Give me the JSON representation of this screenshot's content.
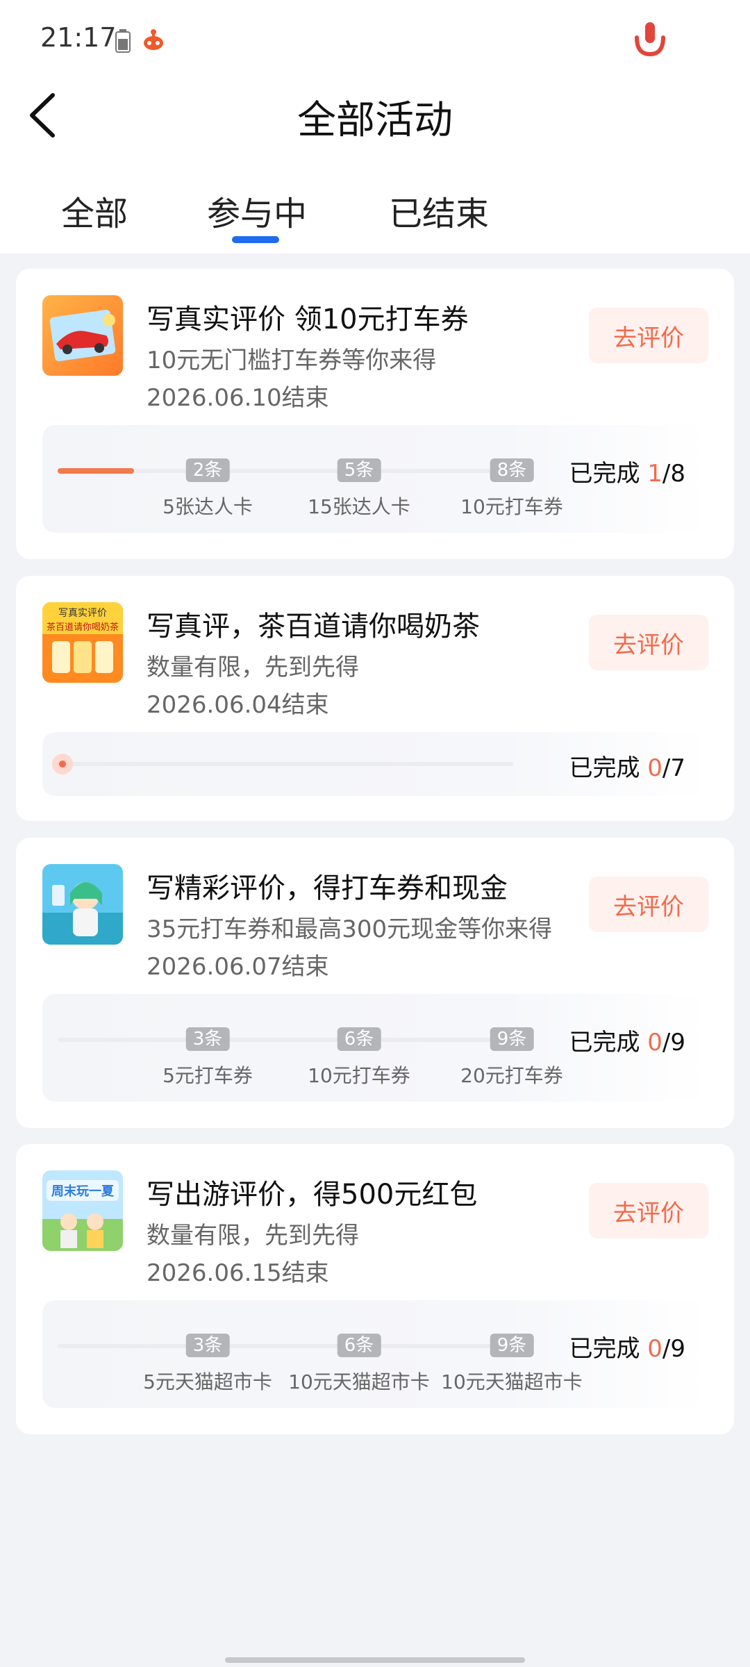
{
  "status_bar": {
    "time": "21:17",
    "icons": [
      "battery-icon",
      "app-badge-icon",
      "mic-icon"
    ]
  },
  "header": {
    "title": "全部活动",
    "back_icon": "chevron-left-icon"
  },
  "tabs": [
    {
      "label": "全部",
      "active": false
    },
    {
      "label": "参与中",
      "active": true
    },
    {
      "label": "已结束",
      "active": false
    }
  ],
  "colors": {
    "accent": "#f26a4b",
    "tab_indicator": "#1f6bf0",
    "background": "#f2f3f7"
  },
  "activities": [
    {
      "title": "写真实评价 领10元打车券",
      "subtitle": "10元无门槛打车券等你来得",
      "date": "2026.06.10结束",
      "button": "去评价",
      "completed_label": "已完成",
      "completed": "1",
      "total": "/8",
      "progress_fraction": 0.125,
      "milestones": [
        {
          "tag": "2条",
          "label": "5张达人卡"
        },
        {
          "tag": "5条",
          "label": "15张达人卡"
        },
        {
          "tag": "8条",
          "label": "10元打车券"
        }
      ]
    },
    {
      "title": "写真评，茶百道请你喝奶茶",
      "subtitle": "数量有限，先到先得",
      "date": "2026.06.04结束",
      "button": "去评价",
      "completed_label": "已完成",
      "completed": "0",
      "total": "/7",
      "progress_fraction": 0,
      "thumb_text": [
        "写真实评价",
        "茶百道请你喝奶茶"
      ]
    },
    {
      "title": "写精彩评价，得打车券和现金",
      "subtitle": "35元打车券和最高300元现金等你来得",
      "date": "2026.06.07结束",
      "button": "去评价",
      "completed_label": "已完成",
      "completed": "0",
      "total": "/9",
      "progress_fraction": 0,
      "milestones": [
        {
          "tag": "3条",
          "label": "5元打车券"
        },
        {
          "tag": "6条",
          "label": "10元打车券"
        },
        {
          "tag": "9条",
          "label": "20元打车券"
        }
      ]
    },
    {
      "title": "写出游评价，得500元红包",
      "subtitle": "数量有限，先到先得",
      "date": "2026.06.15结束",
      "button": "去评价",
      "completed_label": "已完成",
      "completed": "0",
      "total": "/9",
      "progress_fraction": 0,
      "thumb_text": [
        "周末玩一夏"
      ],
      "milestones": [
        {
          "tag": "3条",
          "label": "5元天猫超市卡"
        },
        {
          "tag": "6条",
          "label": "10元天猫超市卡"
        },
        {
          "tag": "9条",
          "label": "10元天猫超市卡"
        }
      ]
    }
  ]
}
